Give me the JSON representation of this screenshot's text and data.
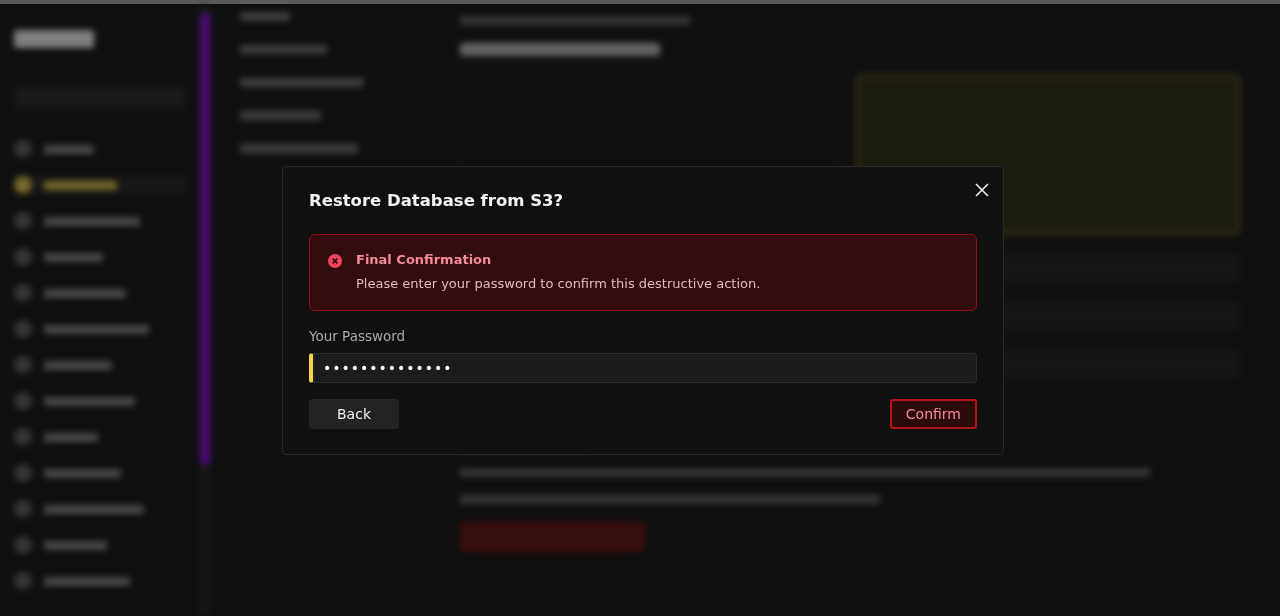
{
  "dialog": {
    "title": "Restore Database from S3?",
    "alert": {
      "kind": "error",
      "title": "Final Confirmation",
      "message": "Please enter your password to confirm this destructive action."
    },
    "password_field": {
      "label": "Your Password",
      "value": "••••••••••••••",
      "focused": true
    },
    "buttons": [
      {
        "label": "Back",
        "kind": "secondary"
      },
      {
        "label": "Confirm",
        "kind": "danger"
      }
    ]
  }
}
